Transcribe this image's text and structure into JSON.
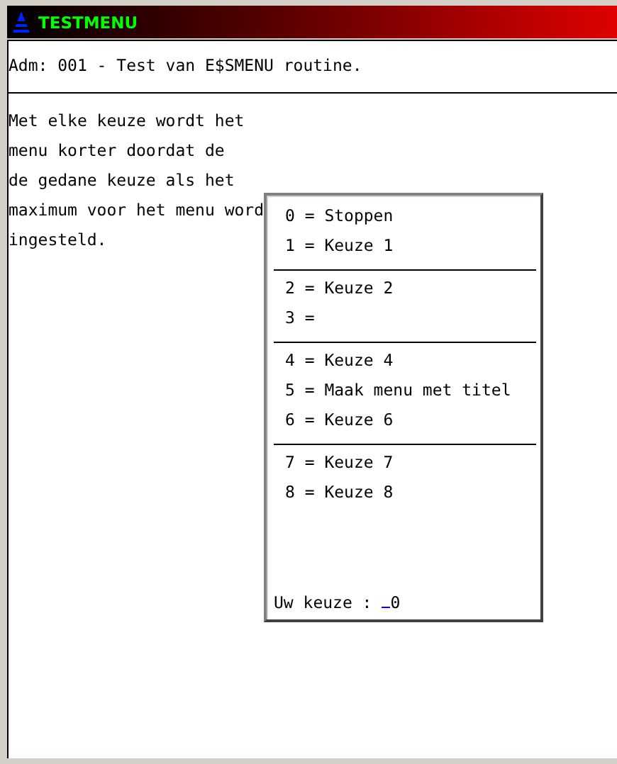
{
  "window": {
    "title": "TESTMENU"
  },
  "header": "Adm: 001 - Test van E$SMENU routine.",
  "body_lines": [
    "Met elke keuze wordt het",
    "menu korter doordat de",
    "de gedane keuze als het",
    "maximum voor het menu word",
    "ingesteld."
  ],
  "menu": {
    "groups": [
      {
        "items": [
          "0 = Stoppen",
          "1 = Keuze 1"
        ]
      },
      {
        "items": [
          "2 = Keuze 2",
          "3 ="
        ]
      },
      {
        "items": [
          "4 = Keuze 4",
          "5 = Maak menu met titel",
          "6 = Keuze 6"
        ]
      },
      {
        "items": [
          "7 = Keuze 7",
          "8 = Keuze 8"
        ]
      }
    ],
    "prompt": {
      "label": "Uw keuze :",
      "value": "0"
    }
  }
}
